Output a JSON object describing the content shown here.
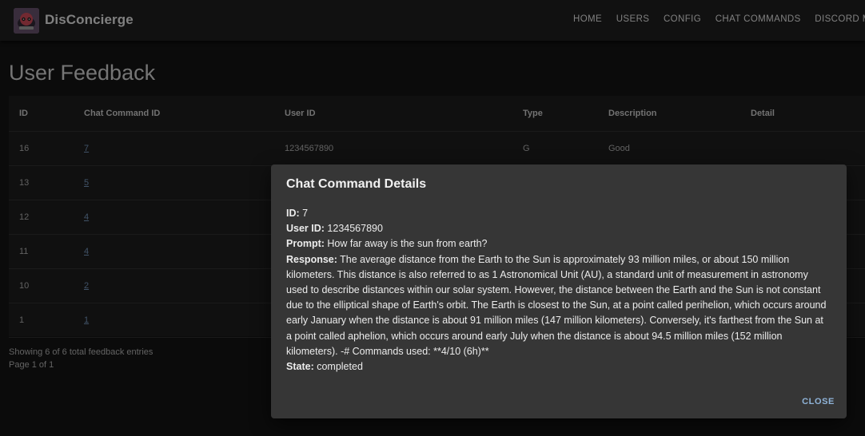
{
  "appbar": {
    "brand": "DisConcierge",
    "nav": [
      "HOME",
      "USERS",
      "CONFIG",
      "CHAT COMMANDS",
      "DISCORD MESSAG"
    ]
  },
  "page": {
    "title": "User Feedback",
    "columns": [
      "ID",
      "Chat Command ID",
      "User ID",
      "Type",
      "Description",
      "Detail"
    ],
    "rows": [
      {
        "id": "16",
        "chat_command_id": "7",
        "user_id": "1234567890",
        "type": "G",
        "description": "Good",
        "detail": ""
      },
      {
        "id": "13",
        "chat_command_id": "5",
        "user_id": "",
        "type": "",
        "description": "",
        "detail": ""
      },
      {
        "id": "12",
        "chat_command_id": "4",
        "user_id": "",
        "type": "",
        "description": "",
        "detail": ""
      },
      {
        "id": "11",
        "chat_command_id": "4",
        "user_id": "",
        "type": "",
        "description": "",
        "detail": ""
      },
      {
        "id": "10",
        "chat_command_id": "2",
        "user_id": "",
        "type": "",
        "description": "",
        "detail": ""
      },
      {
        "id": "1",
        "chat_command_id": "1",
        "user_id": "",
        "type": "",
        "description": "",
        "detail": ""
      }
    ],
    "showing": "Showing 6 of 6 total feedback entries",
    "page_info": "Page 1 of 1"
  },
  "dialog": {
    "title": "Chat Command Details",
    "id_label": "ID:",
    "id_value": "7",
    "user_label": "User ID:",
    "user_value": "1234567890",
    "prompt_label": "Prompt:",
    "prompt_value": "How far away is the sun from earth?",
    "response_label": "Response:",
    "response_value": "The average distance from the Earth to the Sun is approximately 93 million miles, or about 150 million kilometers. This distance is also referred to as 1 Astronomical Unit (AU), a standard unit of measurement in astronomy used to describe distances within our solar system. However, the distance between the Earth and the Sun is not constant due to the elliptical shape of Earth's orbit. The Earth is closest to the Sun, at a point called perihelion, which occurs around early January when the distance is about 91 million miles (147 million kilometers). Conversely, it's farthest from the Sun at a point called aphelion, which occurs around early July when the distance is about 94.5 million miles (152 million kilometers). -# Commands used: **4/10 (6h)**",
    "state_label": "State:",
    "state_value": "completed",
    "close_label": "CLOSE"
  },
  "colors": {
    "link": "#6a86a8",
    "close": "#8fb3d8",
    "dialog_bg": "#363636"
  },
  "icons": {
    "logo": "robot-avatar-icon"
  }
}
